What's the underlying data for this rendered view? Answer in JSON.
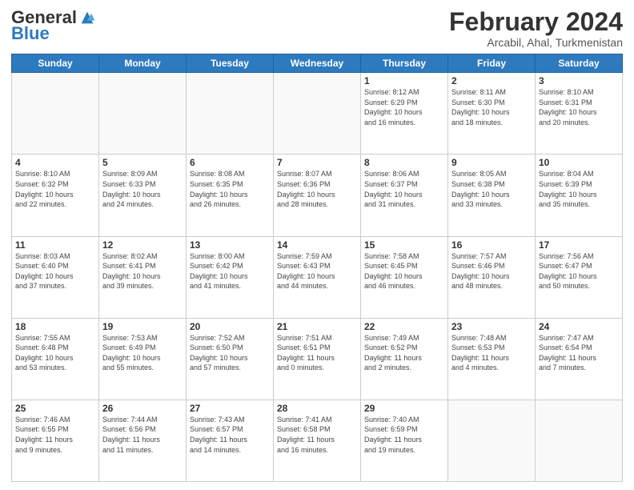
{
  "header": {
    "logo_general": "General",
    "logo_blue": "Blue",
    "title": "February 2024",
    "subtitle": "Arcabil, Ahal, Turkmenistan"
  },
  "days_of_week": [
    "Sunday",
    "Monday",
    "Tuesday",
    "Wednesday",
    "Thursday",
    "Friday",
    "Saturday"
  ],
  "weeks": [
    [
      {
        "day": "",
        "info": ""
      },
      {
        "day": "",
        "info": ""
      },
      {
        "day": "",
        "info": ""
      },
      {
        "day": "",
        "info": ""
      },
      {
        "day": "1",
        "info": "Sunrise: 8:12 AM\nSunset: 6:29 PM\nDaylight: 10 hours\nand 16 minutes."
      },
      {
        "day": "2",
        "info": "Sunrise: 8:11 AM\nSunset: 6:30 PM\nDaylight: 10 hours\nand 18 minutes."
      },
      {
        "day": "3",
        "info": "Sunrise: 8:10 AM\nSunset: 6:31 PM\nDaylight: 10 hours\nand 20 minutes."
      }
    ],
    [
      {
        "day": "4",
        "info": "Sunrise: 8:10 AM\nSunset: 6:32 PM\nDaylight: 10 hours\nand 22 minutes."
      },
      {
        "day": "5",
        "info": "Sunrise: 8:09 AM\nSunset: 6:33 PM\nDaylight: 10 hours\nand 24 minutes."
      },
      {
        "day": "6",
        "info": "Sunrise: 8:08 AM\nSunset: 6:35 PM\nDaylight: 10 hours\nand 26 minutes."
      },
      {
        "day": "7",
        "info": "Sunrise: 8:07 AM\nSunset: 6:36 PM\nDaylight: 10 hours\nand 28 minutes."
      },
      {
        "day": "8",
        "info": "Sunrise: 8:06 AM\nSunset: 6:37 PM\nDaylight: 10 hours\nand 31 minutes."
      },
      {
        "day": "9",
        "info": "Sunrise: 8:05 AM\nSunset: 6:38 PM\nDaylight: 10 hours\nand 33 minutes."
      },
      {
        "day": "10",
        "info": "Sunrise: 8:04 AM\nSunset: 6:39 PM\nDaylight: 10 hours\nand 35 minutes."
      }
    ],
    [
      {
        "day": "11",
        "info": "Sunrise: 8:03 AM\nSunset: 6:40 PM\nDaylight: 10 hours\nand 37 minutes."
      },
      {
        "day": "12",
        "info": "Sunrise: 8:02 AM\nSunset: 6:41 PM\nDaylight: 10 hours\nand 39 minutes."
      },
      {
        "day": "13",
        "info": "Sunrise: 8:00 AM\nSunset: 6:42 PM\nDaylight: 10 hours\nand 41 minutes."
      },
      {
        "day": "14",
        "info": "Sunrise: 7:59 AM\nSunset: 6:43 PM\nDaylight: 10 hours\nand 44 minutes."
      },
      {
        "day": "15",
        "info": "Sunrise: 7:58 AM\nSunset: 6:45 PM\nDaylight: 10 hours\nand 46 minutes."
      },
      {
        "day": "16",
        "info": "Sunrise: 7:57 AM\nSunset: 6:46 PM\nDaylight: 10 hours\nand 48 minutes."
      },
      {
        "day": "17",
        "info": "Sunrise: 7:56 AM\nSunset: 6:47 PM\nDaylight: 10 hours\nand 50 minutes."
      }
    ],
    [
      {
        "day": "18",
        "info": "Sunrise: 7:55 AM\nSunset: 6:48 PM\nDaylight: 10 hours\nand 53 minutes."
      },
      {
        "day": "19",
        "info": "Sunrise: 7:53 AM\nSunset: 6:49 PM\nDaylight: 10 hours\nand 55 minutes."
      },
      {
        "day": "20",
        "info": "Sunrise: 7:52 AM\nSunset: 6:50 PM\nDaylight: 10 hours\nand 57 minutes."
      },
      {
        "day": "21",
        "info": "Sunrise: 7:51 AM\nSunset: 6:51 PM\nDaylight: 11 hours\nand 0 minutes."
      },
      {
        "day": "22",
        "info": "Sunrise: 7:49 AM\nSunset: 6:52 PM\nDaylight: 11 hours\nand 2 minutes."
      },
      {
        "day": "23",
        "info": "Sunrise: 7:48 AM\nSunset: 6:53 PM\nDaylight: 11 hours\nand 4 minutes."
      },
      {
        "day": "24",
        "info": "Sunrise: 7:47 AM\nSunset: 6:54 PM\nDaylight: 11 hours\nand 7 minutes."
      }
    ],
    [
      {
        "day": "25",
        "info": "Sunrise: 7:46 AM\nSunset: 6:55 PM\nDaylight: 11 hours\nand 9 minutes."
      },
      {
        "day": "26",
        "info": "Sunrise: 7:44 AM\nSunset: 6:56 PM\nDaylight: 11 hours\nand 11 minutes."
      },
      {
        "day": "27",
        "info": "Sunrise: 7:43 AM\nSunset: 6:57 PM\nDaylight: 11 hours\nand 14 minutes."
      },
      {
        "day": "28",
        "info": "Sunrise: 7:41 AM\nSunset: 6:58 PM\nDaylight: 11 hours\nand 16 minutes."
      },
      {
        "day": "29",
        "info": "Sunrise: 7:40 AM\nSunset: 6:59 PM\nDaylight: 11 hours\nand 19 minutes."
      },
      {
        "day": "",
        "info": ""
      },
      {
        "day": "",
        "info": ""
      }
    ]
  ]
}
